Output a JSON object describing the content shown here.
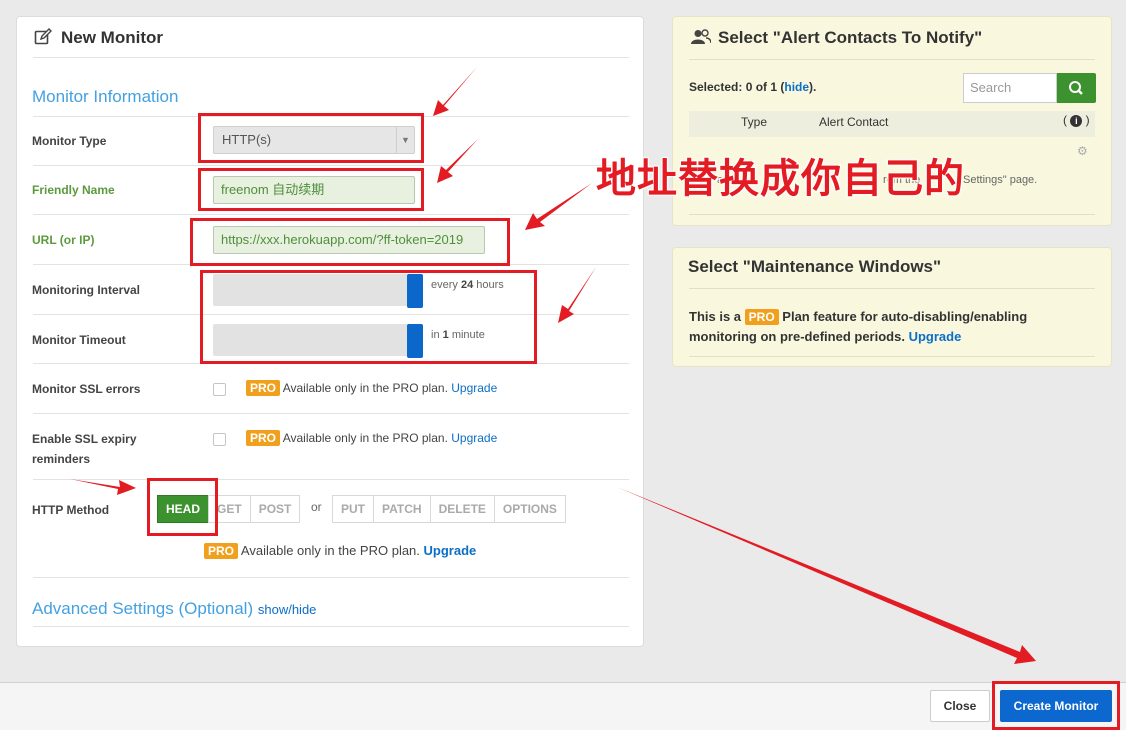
{
  "left_panel": {
    "title": "New Monitor",
    "section_info": "Monitor Information",
    "fields": {
      "monitor_type_label": "Monitor Type",
      "monitor_type_value": "HTTP(s)",
      "friendly_name_label": "Friendly Name",
      "friendly_name_value": "freenom 自动续期",
      "url_label": "URL (or IP)",
      "url_value": "https://xxx.herokuapp.com/?ff-token=2019",
      "interval_label": "Monitoring Interval",
      "interval_prefix": "every",
      "interval_value": "24",
      "interval_unit": "hours",
      "interval_level": 1.0,
      "timeout_label": "Monitor Timeout",
      "timeout_prefix": "in",
      "timeout_value": "1",
      "timeout_unit": "minute",
      "timeout_level": 1.0,
      "ssl_errors_label": "Monitor SSL errors",
      "ssl_expiry_label_1": "Enable SSL expiry",
      "ssl_expiry_label_2": "reminders",
      "pro_badge": "PRO",
      "pro_text": "Available only in the PRO plan.",
      "upgrade": "Upgrade",
      "http_method_label": "HTTP Method",
      "methods_group1": [
        "HEAD",
        "GET",
        "POST"
      ],
      "or": "or",
      "methods_group2": [
        "PUT",
        "PATCH",
        "DELETE",
        "OPTIONS"
      ],
      "active_method": "HEAD"
    },
    "section_advanced": "Advanced Settings (Optional)",
    "show_hide": "show/hide"
  },
  "alerts_panel": {
    "title": "Select \"Alert Contacts To Notify\"",
    "selected_prefix": "Selected: 0 of 1 (",
    "hide": "hide",
    "selected_suffix": ").",
    "search_placeholder": "Search",
    "col_type": "Type",
    "col_contact": "Alert Contact",
    "row_fragment_1": "alert",
    "row_fragment_2": "rom the",
    "row_fragment_3": "Settings\" page."
  },
  "maint_panel": {
    "title": "Select \"Maintenance Windows\"",
    "text_1": "This is a",
    "pro": "PRO",
    "text_2": "Plan feature for auto-disabling/enabling",
    "text_3": "monitoring on pre-defined periods.",
    "upgrade": "Upgrade"
  },
  "annotation": {
    "text": "地址替换成你自己的"
  },
  "footer": {
    "close": "Close",
    "create": "Create Monitor"
  },
  "colors": {
    "accent_blue": "#0c67cf",
    "section_blue": "#43a1e1",
    "pro_orange": "#f0a01c",
    "method_green": "#3b922e",
    "annotation_red": "#e31b23"
  }
}
